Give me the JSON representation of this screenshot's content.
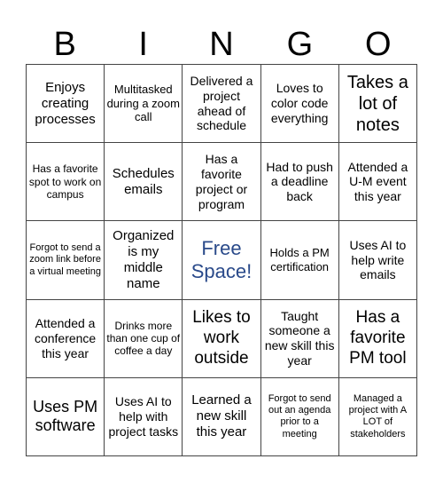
{
  "header": [
    "B",
    "I",
    "N",
    "G",
    "O"
  ],
  "free_color": "#2a4a8a",
  "rows": [
    [
      {
        "text": "Enjoys creating processes",
        "size": 15
      },
      {
        "text": "Multitasked during a zoom call",
        "size": 13
      },
      {
        "text": "Delivered a project ahead of schedule",
        "size": 14
      },
      {
        "text": "Loves to color code everything",
        "size": 14
      },
      {
        "text": "Takes a lot of notes",
        "size": 20
      }
    ],
    [
      {
        "text": "Has a favorite spot to work on campus",
        "size": 12
      },
      {
        "text": "Schedules emails",
        "size": 15
      },
      {
        "text": "Has a favorite project or program",
        "size": 14
      },
      {
        "text": "Had to push a deadline back",
        "size": 14
      },
      {
        "text": "Attended a U-M event this year",
        "size": 14
      }
    ],
    [
      {
        "text": "Forgot to send a zoom link before a virtual meeting",
        "size": 11
      },
      {
        "text": "Organized is my middle name",
        "size": 15
      },
      {
        "text": "Free Space!",
        "size": 22,
        "free": true
      },
      {
        "text": "Holds a PM certification",
        "size": 13
      },
      {
        "text": "Uses AI to help write emails",
        "size": 14
      }
    ],
    [
      {
        "text": "Attended a conference this year",
        "size": 14
      },
      {
        "text": "Drinks more than one cup of coffee a day",
        "size": 12
      },
      {
        "text": "Likes to work outside",
        "size": 19
      },
      {
        "text": "Taught someone a new skill this year",
        "size": 14
      },
      {
        "text": "Has a favorite PM tool",
        "size": 19
      }
    ],
    [
      {
        "text": "Uses PM software",
        "size": 18
      },
      {
        "text": "Uses AI to help with project tasks",
        "size": 14
      },
      {
        "text": "Learned a new skill this year",
        "size": 15
      },
      {
        "text": "Forgot to send out an agenda prior to a meeting",
        "size": 11
      },
      {
        "text": "Managed a project with A LOT of stakeholders",
        "size": 11
      }
    ]
  ]
}
